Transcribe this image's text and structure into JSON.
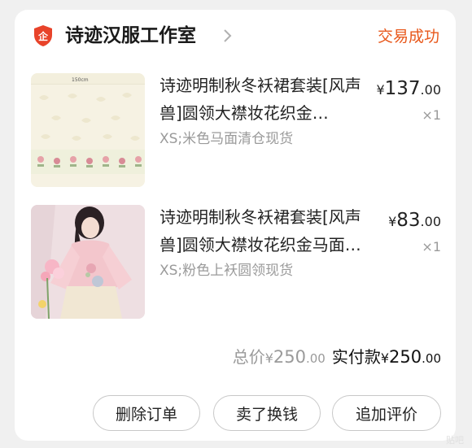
{
  "shop": {
    "name": "诗迹汉服工作室",
    "status": "交易成功",
    "icon": "enterprise-shield-icon",
    "accent_color": "#e8581b",
    "icon_color": "#e8432a"
  },
  "items": [
    {
      "title": "诗迹明制秋冬袄裙套装[风声兽]圆领大襟妆花织金…",
      "sku": "XS;米色马面清仓现货",
      "price_yen": "¥",
      "price_int": "137",
      "price_dec": ".00",
      "qty": "×1",
      "thumb_label": "150cm"
    },
    {
      "title": "诗迹明制秋冬袄裙套装[风声兽]圆领大襟妆花织金马面…",
      "sku": "XS;粉色上袄圆领现货",
      "price_yen": "¥",
      "price_int": "83",
      "price_dec": ".00",
      "qty": "×1"
    }
  ],
  "totals": {
    "total_label": "总价",
    "total_yen": "¥",
    "total_int": "250",
    "total_dec": ".00",
    "paid_label": "实付款",
    "paid_yen": "¥",
    "paid_int": "250",
    "paid_dec": ".00"
  },
  "actions": {
    "delete_label": "删除订单",
    "sell_label": "卖了换钱",
    "review_label": "追加评价"
  },
  "watermark": "贴吧"
}
